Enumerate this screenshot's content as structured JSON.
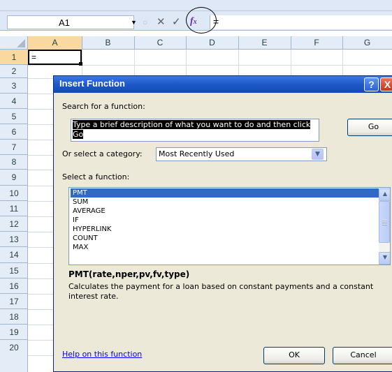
{
  "formula_bar": {
    "name_box_value": "A1",
    "name_box_arrow": "▼",
    "cancel_glyph": "✕",
    "enter_glyph": "✓",
    "fx_label": "fx",
    "formula_text": "="
  },
  "columns": [
    "A",
    "B",
    "C",
    "D",
    "E",
    "F",
    "G"
  ],
  "rows": [
    "1",
    "2",
    "3",
    "4",
    "5",
    "6",
    "7",
    "8",
    "9",
    "10",
    "11",
    "12",
    "13",
    "14",
    "15",
    "16",
    "17",
    "18",
    "19",
    "20"
  ],
  "cells": {
    "A1": "="
  },
  "dialog": {
    "title": "Insert Function",
    "help_glyph": "?",
    "close_glyph": "X",
    "search_label": "Search for a function:",
    "search_value": "Type a brief description of what you want to do and then click Go",
    "go_label": "Go",
    "category_label": "Or select a category:",
    "category_value": "Most Recently Used",
    "select_label": "Select a function:",
    "functions": [
      "PMT",
      "SUM",
      "AVERAGE",
      "IF",
      "HYPERLINK",
      "COUNT",
      "MAX"
    ],
    "selected_function": "PMT",
    "signature": "PMT(rate,nper,pv,fv,type)",
    "description": "Calculates the payment for a loan based on constant payments and a constant interest rate.",
    "help_link": "Help on this function",
    "ok_label": "OK",
    "cancel_label": "Cancel"
  },
  "colors": {
    "title_bar": "#1d58c9",
    "selected_item": "#316ac5",
    "active_header": "#f9d99f",
    "dialog_bg": "#ece9d8"
  },
  "icons": [
    "fx-icon",
    "help-icon",
    "close-icon",
    "dropdown-arrow-icon",
    "scroll-up-icon",
    "scroll-down-icon"
  ]
}
